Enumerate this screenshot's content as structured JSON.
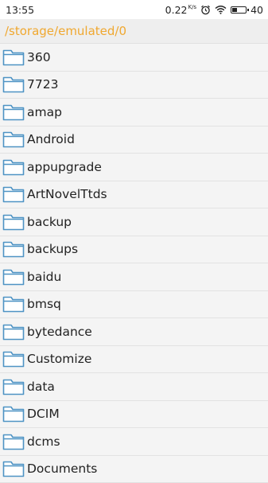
{
  "status_bar": {
    "time": "13:55",
    "net_speed": "0.22",
    "net_speed_unit": "K/s",
    "battery_level": "40",
    "battery_fraction": 0.4
  },
  "path": "/storage/emulated/0",
  "folders": [
    {
      "name": "360"
    },
    {
      "name": "7723"
    },
    {
      "name": "amap"
    },
    {
      "name": "Android"
    },
    {
      "name": "appupgrade"
    },
    {
      "name": "ArtNovelTtds"
    },
    {
      "name": "backup"
    },
    {
      "name": "backups"
    },
    {
      "name": "baidu"
    },
    {
      "name": "bmsq"
    },
    {
      "name": "bytedance"
    },
    {
      "name": "Customize"
    },
    {
      "name": "data"
    },
    {
      "name": "DCIM"
    },
    {
      "name": "dcms"
    },
    {
      "name": "Documents"
    }
  ],
  "icons": {
    "folder": "folder-icon",
    "alarm": "alarm-icon",
    "wifi": "wifi-icon",
    "battery": "battery-icon"
  },
  "colors": {
    "path_text": "#f0a830",
    "folder_stroke": "#4e93c4"
  }
}
